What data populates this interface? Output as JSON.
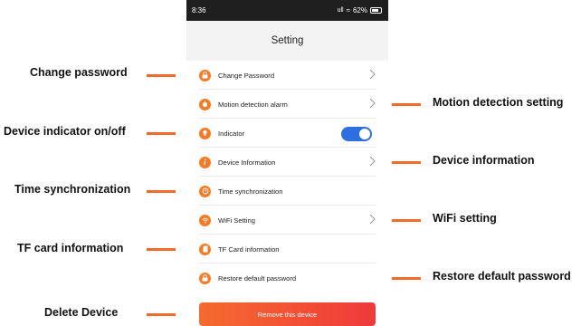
{
  "status_bar": {
    "time": "8:36",
    "signal": "ull",
    "battery_text": "62%"
  },
  "header": {
    "title": "Setting"
  },
  "settings": [
    {
      "label": "Change Password",
      "icon": "lock-icon",
      "control": "chevron"
    },
    {
      "label": "Motion detection alarm",
      "icon": "alarm-icon",
      "control": "chevron"
    },
    {
      "label": "Indicator",
      "icon": "bulb-icon",
      "control": "toggle",
      "toggle_on": true
    },
    {
      "label": "Device Information",
      "icon": "info-icon",
      "control": "chevron"
    },
    {
      "label": "Time synchronization",
      "icon": "clock-icon",
      "control": "none"
    },
    {
      "label": "WiFi Setting",
      "icon": "wifi-icon",
      "control": "chevron"
    },
    {
      "label": "TF Card information",
      "icon": "sd-card-icon",
      "control": "none"
    },
    {
      "label": "Restore default password",
      "icon": "lock-reset-icon",
      "control": "none"
    }
  ],
  "remove_button": {
    "label": "Remove this device"
  },
  "annotations_left": [
    "Change password",
    "Device indicator on/off",
    "Time synchronization",
    "TF card information",
    "Delete Device"
  ],
  "annotations_right": [
    "Motion detection setting",
    "Device information",
    "WiFi setting",
    "Restore default password"
  ],
  "colors": {
    "accent": "#f47a25",
    "toggle": "#2f6ee0",
    "button_start": "#f56b2f",
    "button_end": "#ee3a3b"
  }
}
